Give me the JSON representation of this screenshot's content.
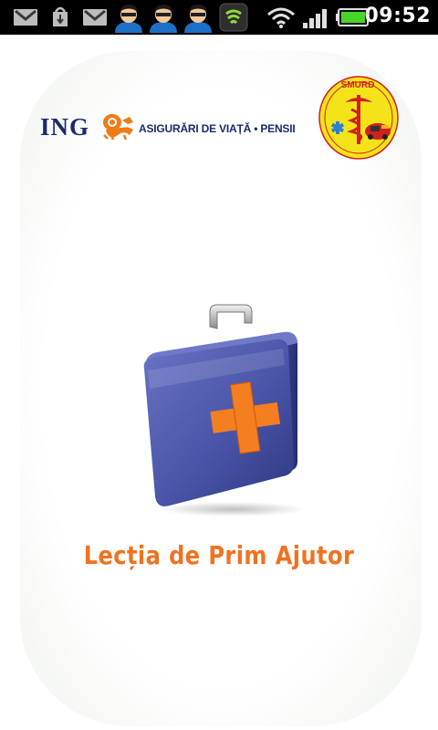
{
  "status_bar": {
    "notifications": [
      "gmail-icon",
      "download-icon",
      "gmail-icon",
      "person-icon",
      "person-icon",
      "person-icon",
      "sync-icon"
    ],
    "wifi_icon": "wifi-icon",
    "signal_icon": "signal-icon",
    "battery_icon": "battery-icon",
    "time": "09:52"
  },
  "splash": {
    "ing_logo": {
      "brand": "ING",
      "tagline": "ASIGURĂRI DE VIAȚĂ • PENSII"
    },
    "smurd_badge": {
      "label": "SMURD"
    },
    "title": "Lecția de Prim Ajutor",
    "colors": {
      "title": "#f07220",
      "kit_body": "#4a55a8",
      "cross": "#f57f20",
      "ing_blue": "#1c2a6b",
      "ing_orange": "#f07a18",
      "smurd_yellow": "#f5e31a"
    }
  }
}
